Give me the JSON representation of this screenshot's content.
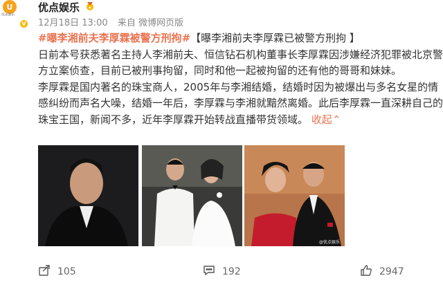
{
  "account": {
    "avatar_glyph": "U",
    "avatar_label": "优点娱乐",
    "name": "优点娱乐",
    "badge_icon": "gold-medal-icon",
    "vip_icon": "verified-vip-icon"
  },
  "meta": {
    "time": "12月18日 13:00",
    "source": "来自 微博网页版"
  },
  "post": {
    "hashtag": "#曝李湘前夫李厚霖被警方刑拘#",
    "title": "【曝李湘前夫李厚霖已被警方刑拘 】",
    "para1": "日前本号获悉著名主持人李湘前夫、恒信钻石机构董事长李厚霖因涉嫌经济犯罪被北京警方立案侦查，目前已被刑事拘留，同时和他一起被拘留的还有他的哥哥和妹妹。",
    "para2": "李厚霖是国内著名的珠宝商人，2005年与李湘结婚，结婚时因为被爆出与多名女星的情感纠纷而声名大噪，结婚一年后，李厚霖与李湘就黯然离婚。此后李厚霖一直深耕自己的珠宝王国，新闻不多，近年李厚霖开始转战直播带货领域。",
    "collapse_label": "收起",
    "collapse_icon": "chevron-up-icon"
  },
  "photos": [
    {
      "name": "portrait-photo",
      "watermark": ""
    },
    {
      "name": "wedding-photo",
      "watermark": ""
    },
    {
      "name": "couple-photo",
      "watermark": "@优点娱乐"
    }
  ],
  "actions": {
    "share_icon": "share-icon",
    "share_count": "105",
    "comment_icon": "comment-icon",
    "comment_count": "192",
    "like_icon": "thumbs-up-icon",
    "like_count": "2947"
  },
  "colors": {
    "accent": "#eb7350",
    "gold": "#f7a21b",
    "text": "#333333",
    "muted": "#888888"
  }
}
